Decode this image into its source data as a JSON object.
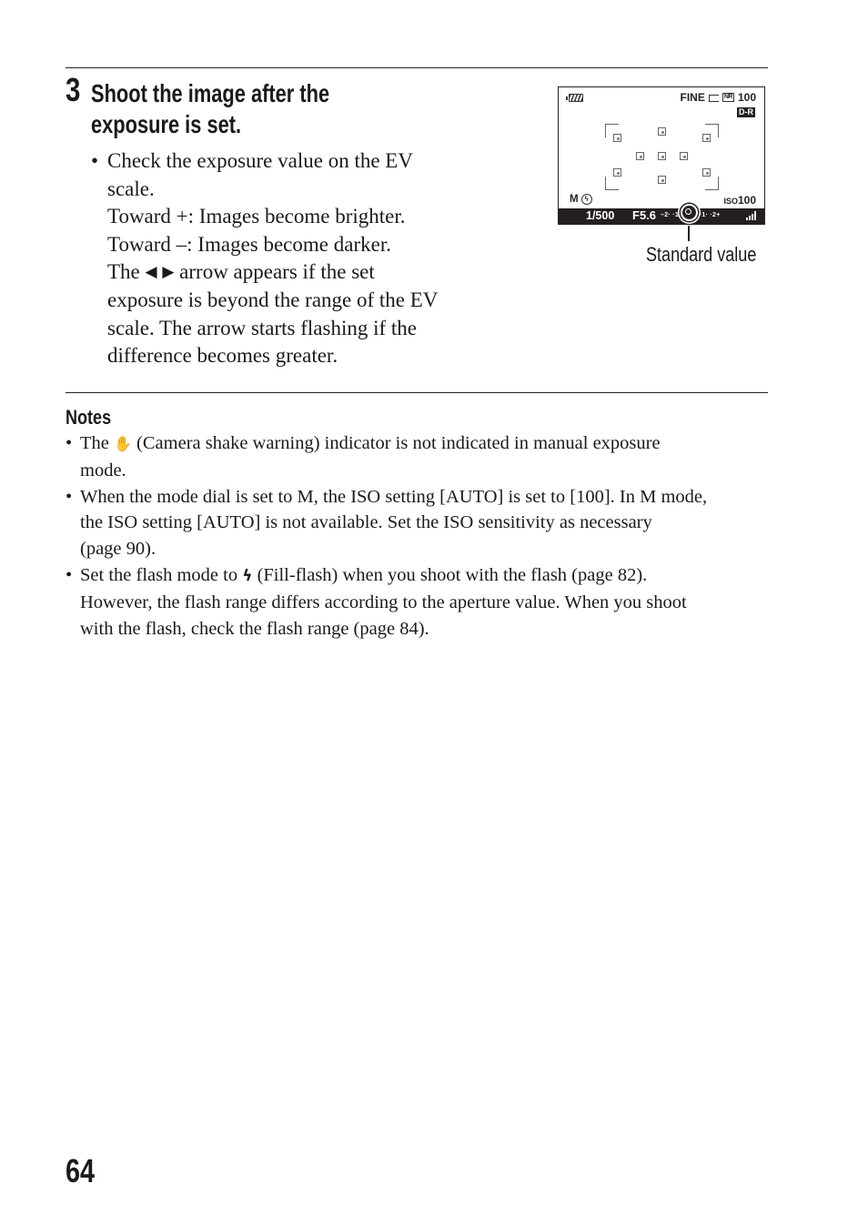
{
  "step": {
    "number": "3",
    "title_lines": [
      "Shoot the image after the",
      "exposure is set."
    ],
    "bullet": "•",
    "body_lines": [
      "Check the exposure value on the EV",
      "scale.",
      "Toward +: Images become brighter.",
      "Toward –: Images become darker."
    ],
    "arrow_line_pre": "The ",
    "arrow_left": "◀",
    "arrow_right": "▶",
    "arrow_line_post": " arrow appears if the set",
    "more_lines": [
      "exposure is beyond the range of the EV",
      "scale. The arrow starts flashing if the",
      "difference becomes greater."
    ]
  },
  "lcd": {
    "quality": "FINE",
    "nr_badge": "NR",
    "image_count": "100",
    "dr_badge": "D-R",
    "mode": "M",
    "iso_label": "ISO",
    "iso_value": "100",
    "shutter": "1/500",
    "aperture": "F5.6",
    "ev_scale_left": "–2·  ·1·",
    "ev_scale_right": "·1·  ·2+",
    "callout": "Standard value",
    "icons": {
      "battery": "battery-icon",
      "image_size": "image-size-icon",
      "flash_off": "flash-off-icon",
      "signal": "wireless-signal-icon"
    }
  },
  "notes": {
    "title": "Notes",
    "items": [
      {
        "pre": "The ",
        "icon": "✋",
        "post": " (Camera shake warning) indicator is not indicated in manual exposure",
        "cont": [
          "mode."
        ]
      },
      {
        "pre": "When the mode dial is set to M, the ISO setting [AUTO] is set to [100]. In M mode,",
        "cont": [
          "the ISO setting [AUTO] is not available. Set the ISO sensitivity as necessary",
          "(page 90)."
        ]
      },
      {
        "pre": "Set the flash mode to ",
        "icon": "ϟ",
        "post": " (Fill-flash) when you shoot with the flash (page 82).",
        "cont": [
          "However, the flash range differs according to the aperture value. When you shoot",
          "with the flash, check the flash range (page 84)."
        ]
      }
    ]
  },
  "page_number": "64"
}
